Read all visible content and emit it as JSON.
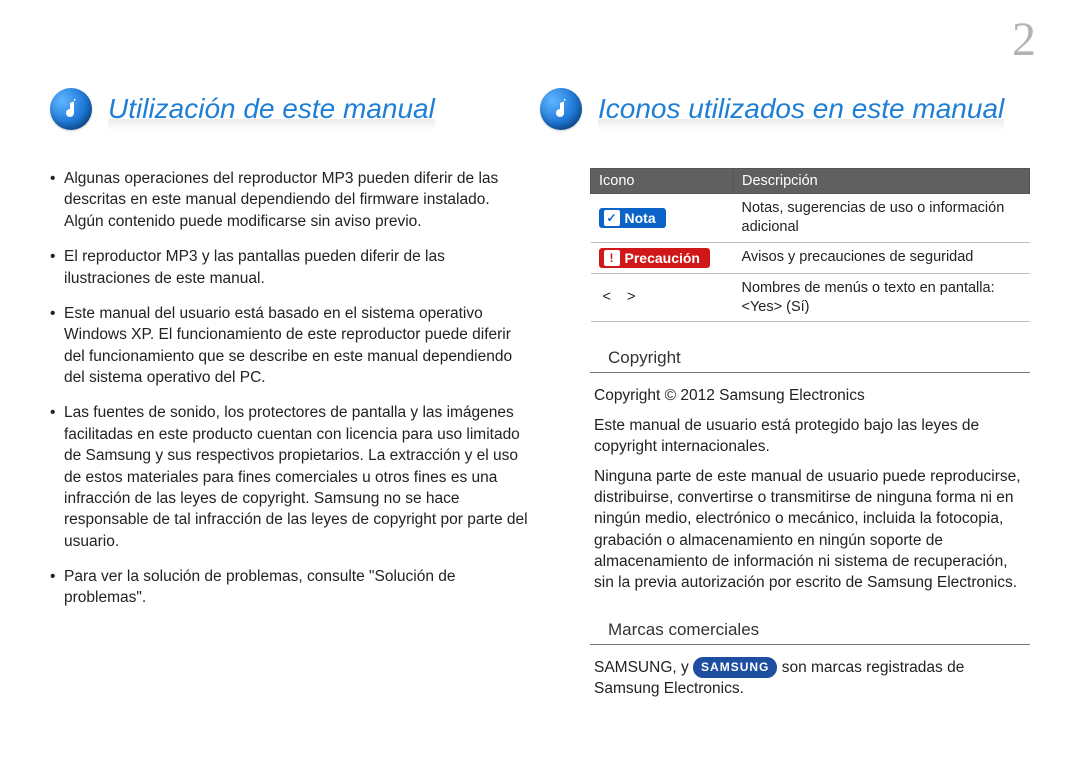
{
  "page_number": "2",
  "headings": {
    "left": "Utilización de este manual",
    "right": "Iconos utilizados en este manual"
  },
  "bullets": [
    "Algunas operaciones del reproductor MP3 pueden diferir de las descritas en este manual dependiendo del firmware instalado. Algún contenido puede modificarse sin aviso previo.",
    "El reproductor MP3 y las pantallas pueden diferir de las ilustraciones de este manual.",
    "Este manual del usuario está basado en el sistema operativo Windows XP. El funcionamiento de este reproductor puede diferir del funcionamiento que se describe en este manual dependiendo del sistema operativo del PC.",
    "Las fuentes de sonido, los protectores de pantalla y las imágenes facilitadas en este producto cuentan con licencia para uso limitado de Samsung y sus respectivos propietarios. La extracción y el uso de estos materiales para fines comerciales u otros fines es una infracción de las leyes de copyright. Samsung no se hace responsable de tal infracción de las leyes de copyright por parte del usuario.",
    "Para ver la solución de problemas, consulte \"Solución de problemas\"."
  ],
  "icon_table": {
    "headers": {
      "icon": "Icono",
      "desc": "Descripción"
    },
    "rows": [
      {
        "label": "Nota",
        "desc": "Notas, sugerencias de uso o información adicional"
      },
      {
        "label": "Precaución",
        "desc": "Avisos y precauciones de seguridad"
      },
      {
        "symbol": "<   >",
        "desc": "Nombres de menús o texto en pantalla: <Yes> (Sí)"
      }
    ]
  },
  "copyright": {
    "title": "Copyright",
    "line1": "Copyright © 2012 Samsung Electronics",
    "line2": "Este manual de usuario está protegido bajo las leyes de copyright internacionales.",
    "line3": "Ninguna parte de este manual de usuario puede reproducirse, distribuirse, convertirse o transmitirse de ninguna forma ni en ningún medio, electrónico o mecánico, incluida la fotocopia, grabación o almacenamiento en ningún soporte de almacenamiento de información ni sistema de recuperación, sin la previa autorización por escrito de Samsung Electronics."
  },
  "trademarks": {
    "title": "Marcas comerciales",
    "prefix": "SAMSUNG, y ",
    "logo_text": "SAMSUNG",
    "suffix": " son marcas registradas de Samsung Electronics."
  }
}
